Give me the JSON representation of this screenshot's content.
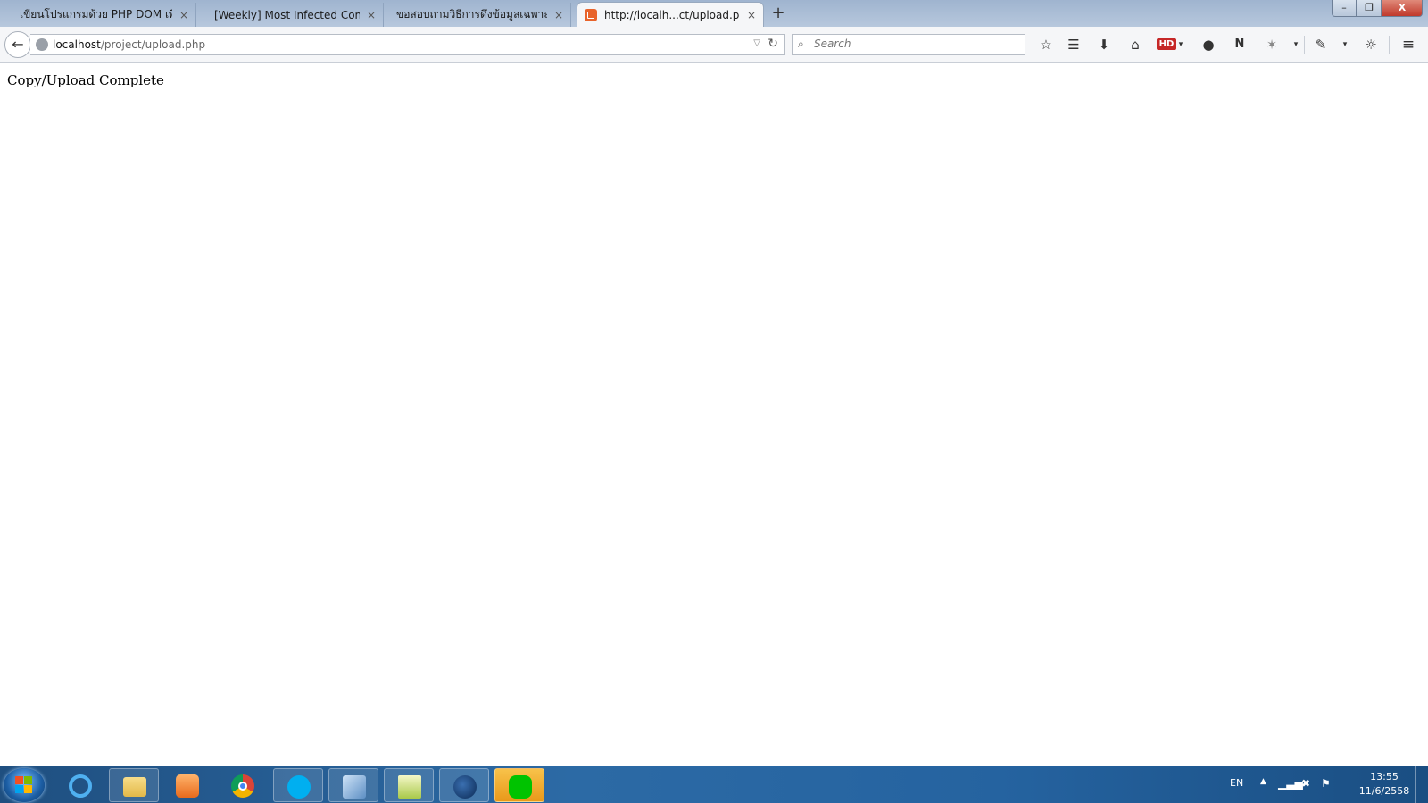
{
  "window": {
    "controls": {
      "minimize": "–",
      "restore": "❐",
      "close": "X"
    }
  },
  "tabs": [
    {
      "label": "เขียนโปรแกรมด้วย PHP DOM เพื่...",
      "active": false
    },
    {
      "label": "[Weekly] Most Infected Compu...",
      "active": false
    },
    {
      "label": "ขอสอบถามวิธีการดึงข้อมูลเฉพาะส่...",
      "active": false
    },
    {
      "label": "http://localh...ct/upload.php",
      "active": true
    }
  ],
  "tab_close": "×",
  "new_tab": "+",
  "navbar": {
    "url_host": "localhost",
    "url_path": "/project/upload.php",
    "search_placeholder": "Search"
  },
  "toolbar_icons": [
    "bookmark-star-icon",
    "reading-list-icon",
    "download-icon",
    "home-icon",
    "hd-addon-icon",
    "chat-icon",
    "onenote-icon",
    "addon-icon",
    "eyedropper-icon",
    "sync-icon",
    "menu-icon"
  ],
  "toolbar": {
    "hd_label": "HD"
  },
  "page": {
    "message": "Copy/Upload Complete"
  },
  "taskbar": {
    "apps": [
      "internet-explorer-icon",
      "file-explorer-icon",
      "media-player-icon",
      "chrome-icon",
      "skype-icon",
      "virtualbox-icon",
      "notepad-plus-icon",
      "firefox-icon",
      "line-icon"
    ],
    "language": "EN",
    "time": "13:55",
    "date": "11/6/2558"
  },
  "colors": {
    "tab_strip": "#9fb4cf",
    "taskbar": "#2c6aa5",
    "favicon": "#e8632b",
    "hd_badge": "#c62828",
    "line_green": "#00c300"
  }
}
